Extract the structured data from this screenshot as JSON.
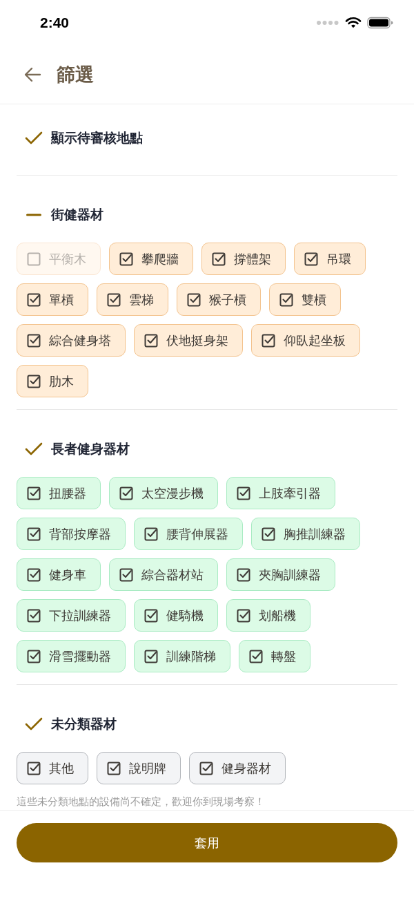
{
  "status_bar": {
    "time": "2:40"
  },
  "header": {
    "title": "篩選"
  },
  "pending_toggle": {
    "label": "顯示待審核地點",
    "checked": true
  },
  "groups": [
    {
      "title": "街健器材",
      "checked": true,
      "indeterminate": true,
      "kind": "orange",
      "items": [
        {
          "label": "平衡木",
          "checked": false
        },
        {
          "label": "攀爬牆",
          "checked": true
        },
        {
          "label": "撐體架",
          "checked": true
        },
        {
          "label": "吊環",
          "checked": true
        },
        {
          "label": "單槓",
          "checked": true
        },
        {
          "label": "雲梯",
          "checked": true
        },
        {
          "label": "猴子槓",
          "checked": true
        },
        {
          "label": "雙槓",
          "checked": true
        },
        {
          "label": "綜合健身塔",
          "checked": true
        },
        {
          "label": "伏地挺身架",
          "checked": true
        },
        {
          "label": "仰臥起坐板",
          "checked": true
        },
        {
          "label": "肋木",
          "checked": true
        }
      ]
    },
    {
      "title": "長者健身器材",
      "checked": true,
      "indeterminate": false,
      "kind": "green",
      "items": [
        {
          "label": "扭腰器",
          "checked": true
        },
        {
          "label": "太空漫步機",
          "checked": true
        },
        {
          "label": "上肢牽引器",
          "checked": true
        },
        {
          "label": "背部按摩器",
          "checked": true
        },
        {
          "label": "腰背伸展器",
          "checked": true
        },
        {
          "label": "胸推訓練器",
          "checked": true
        },
        {
          "label": "健身車",
          "checked": true
        },
        {
          "label": "綜合器材站",
          "checked": true
        },
        {
          "label": "夾胸訓練器",
          "checked": true
        },
        {
          "label": "下拉訓練器",
          "checked": true
        },
        {
          "label": "健騎機",
          "checked": true
        },
        {
          "label": "划船機",
          "checked": true
        },
        {
          "label": "滑雪擺動器",
          "checked": true
        },
        {
          "label": "訓練階梯",
          "checked": true
        },
        {
          "label": "轉盤",
          "checked": true
        }
      ]
    },
    {
      "title": "未分類器材",
      "checked": true,
      "indeterminate": false,
      "kind": "gray",
      "note": "這些未分類地點的設備尚不確定，歡迎你到現場考察！",
      "items": [
        {
          "label": "其他",
          "checked": true
        },
        {
          "label": "說明牌",
          "checked": true
        },
        {
          "label": "健身器材",
          "checked": true
        }
      ]
    }
  ],
  "apply_button": {
    "label": "套用"
  }
}
